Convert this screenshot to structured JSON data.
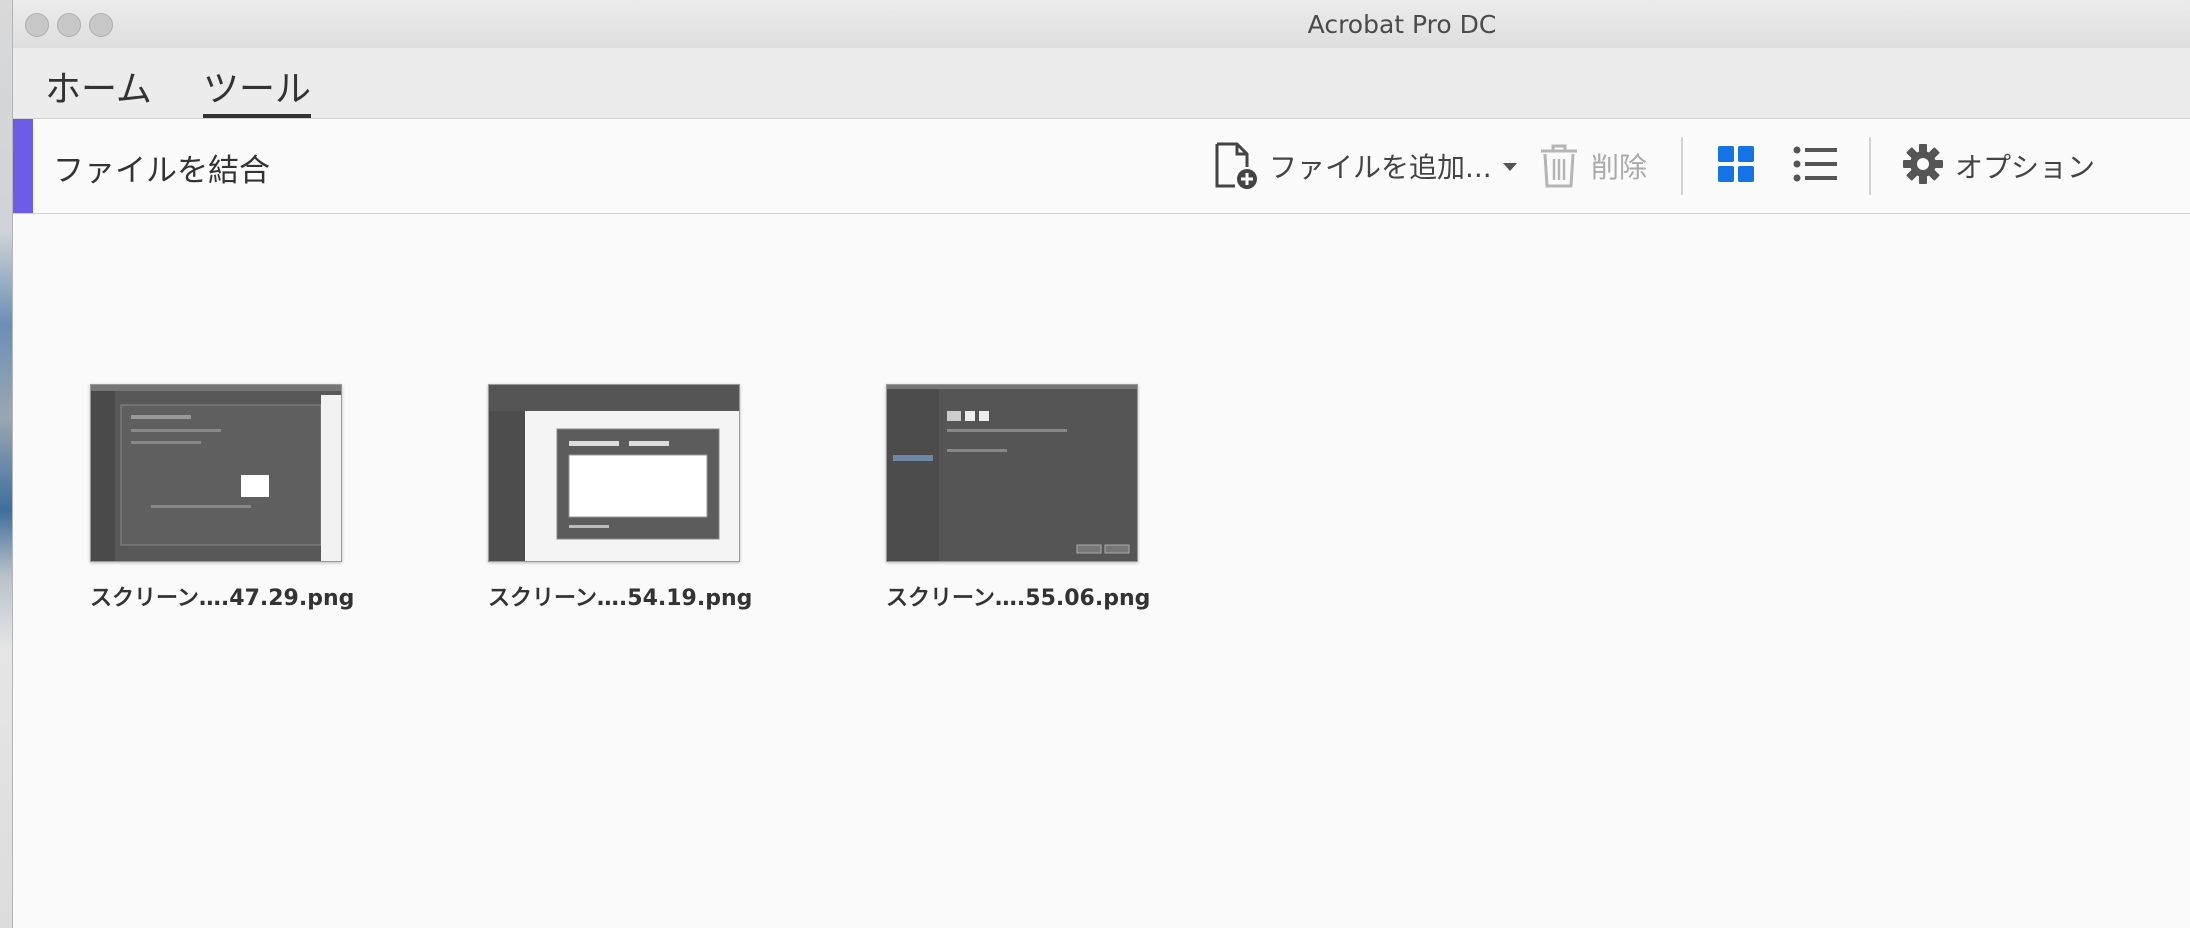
{
  "window": {
    "title": "Acrobat Pro DC"
  },
  "tabs": [
    {
      "label": "ホーム",
      "active": false
    },
    {
      "label": "ツール",
      "active": true
    }
  ],
  "toolbar": {
    "title": "ファイルを結合",
    "add_files_label": "ファイルを追加...",
    "delete_label": "削除",
    "options_label": "オプション",
    "accent_color": "#6c5ce7",
    "active_view_color": "#1473e6"
  },
  "files": [
    {
      "name": "スクリーン….47.29.png"
    },
    {
      "name": "スクリーン….54.19.png"
    },
    {
      "name": "スクリーン….55.06.png"
    }
  ]
}
